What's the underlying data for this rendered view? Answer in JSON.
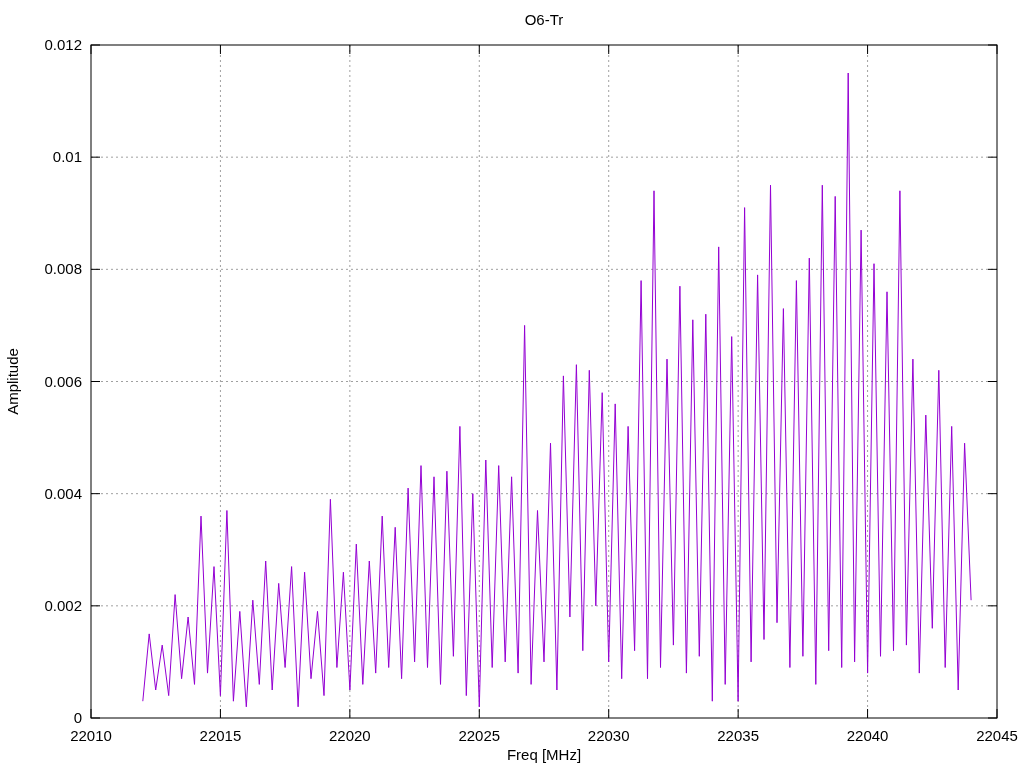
{
  "chart_data": {
    "type": "line",
    "title": "O6-Tr",
    "xlabel": "Freq [MHz]",
    "ylabel": "Amplitude",
    "grid": true,
    "xlim": [
      22010,
      22045
    ],
    "ylim": [
      0,
      0.012
    ],
    "xticks": [
      22010,
      22015,
      22020,
      22025,
      22030,
      22035,
      22040,
      22045
    ],
    "yticks": [
      0,
      0.002,
      0.004,
      0.006,
      0.008,
      0.01,
      0.012
    ],
    "x": [
      22012,
      22012.25,
      22012.5,
      22012.75,
      22013,
      22013.25,
      22013.5,
      22013.75,
      22014,
      22014.25,
      22014.5,
      22014.75,
      22015,
      22015.25,
      22015.5,
      22015.75,
      22016,
      22016.25,
      22016.5,
      22016.75,
      22017,
      22017.25,
      22017.5,
      22017.75,
      22018,
      22018.25,
      22018.5,
      22018.75,
      22019,
      22019.25,
      22019.5,
      22019.75,
      22020,
      22020.25,
      22020.5,
      22020.75,
      22021,
      22021.25,
      22021.5,
      22021.75,
      22022,
      22022.25,
      22022.5,
      22022.75,
      22023,
      22023.25,
      22023.5,
      22023.75,
      22024,
      22024.25,
      22024.5,
      22024.75,
      22025,
      22025.25,
      22025.5,
      22025.75,
      22026,
      22026.25,
      22026.5,
      22026.75,
      22027,
      22027.25,
      22027.5,
      22027.75,
      22028,
      22028.25,
      22028.5,
      22028.75,
      22029,
      22029.25,
      22029.5,
      22029.75,
      22030,
      22030.25,
      22030.5,
      22030.75,
      22031,
      22031.25,
      22031.5,
      22031.75,
      22032,
      22032.25,
      22032.5,
      22032.75,
      22033,
      22033.25,
      22033.5,
      22033.75,
      22034,
      22034.25,
      22034.5,
      22034.75,
      22035,
      22035.25,
      22035.5,
      22035.75,
      22036,
      22036.25,
      22036.5,
      22036.75,
      22037,
      22037.25,
      22037.5,
      22037.75,
      22038,
      22038.25,
      22038.5,
      22038.75,
      22039,
      22039.25,
      22039.5,
      22039.75,
      22040,
      22040.25,
      22040.5,
      22040.75,
      22041,
      22041.25,
      22041.5,
      22041.75,
      22042,
      22042.25,
      22042.5,
      22042.75,
      22043,
      22043.25,
      22043.5,
      22043.75,
      22044
    ],
    "series": [
      {
        "color": "#9400d3",
        "values": [
          0.0003,
          0.0015,
          0.0005,
          0.0013,
          0.0004,
          0.0022,
          0.0007,
          0.0018,
          0.0006,
          0.0036,
          0.0008,
          0.0027,
          0.0004,
          0.0037,
          0.0003,
          0.0019,
          0.0002,
          0.0021,
          0.0006,
          0.0028,
          0.0005,
          0.0024,
          0.0009,
          0.0027,
          0.0002,
          0.0026,
          0.0007,
          0.0019,
          0.0004,
          0.0039,
          0.0009,
          0.0026,
          0.0005,
          0.0031,
          0.0006,
          0.0028,
          0.0008,
          0.0036,
          0.0009,
          0.0034,
          0.0007,
          0.0041,
          0.001,
          0.0045,
          0.0009,
          0.0043,
          0.0006,
          0.0044,
          0.0011,
          0.0052,
          0.0004,
          0.004,
          0.0002,
          0.0046,
          0.0009,
          0.0045,
          0.001,
          0.0043,
          0.0008,
          0.007,
          0.0006,
          0.0037,
          0.001,
          0.0049,
          0.0005,
          0.0061,
          0.0018,
          0.0063,
          0.0012,
          0.0062,
          0.002,
          0.0058,
          0.001,
          0.0056,
          0.0007,
          0.0052,
          0.0012,
          0.0078,
          0.0007,
          0.0094,
          0.0009,
          0.0064,
          0.0013,
          0.0077,
          0.0008,
          0.0071,
          0.0011,
          0.0072,
          0.0003,
          0.0084,
          0.0006,
          0.0068,
          0.0003,
          0.0091,
          0.001,
          0.0079,
          0.0014,
          0.0095,
          0.0017,
          0.0073,
          0.0009,
          0.0078,
          0.0011,
          0.0082,
          0.0006,
          0.0095,
          0.0012,
          0.0093,
          0.0009,
          0.0115,
          0.001,
          0.0087,
          0.0008,
          0.0081,
          0.0011,
          0.0076,
          0.0012,
          0.0094,
          0.0013,
          0.0064,
          0.0008,
          0.0054,
          0.0016,
          0.0062,
          0.0009,
          0.0052,
          0.0005,
          0.0049,
          0.0021
        ]
      }
    ]
  }
}
